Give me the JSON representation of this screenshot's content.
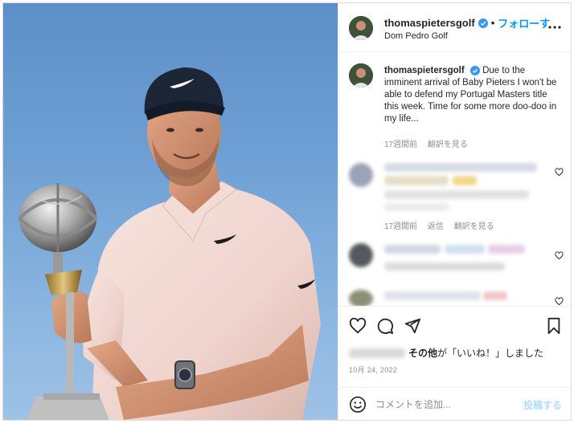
{
  "post": {
    "username": "thomaspietersgolf",
    "follow_separator": "•",
    "follow_label": "フォローす",
    "location": "Dom Pedro Golf"
  },
  "caption": {
    "username": "thomaspietersgolf",
    "text": "Due to the imminent arrival of Baby Pieters I won't be able to defend my Portugal Masters title this week. Time for some more doo-doo in my life...",
    "time": "17週間前",
    "translate": "翻訳を見る"
  },
  "comments": [
    {
      "time": "17週間前",
      "reply": "返信",
      "translate": "翻訳を見る"
    }
  ],
  "actions": {
    "likes_suffix": "が「いいね！」しました",
    "likes_bold": "その他",
    "date": "10月 24, 2022"
  },
  "comment_box": {
    "placeholder": "コメントを追加...",
    "post_label": "投稿する"
  },
  "colors": {
    "accent": "#0095f6",
    "verified": "#3897f0",
    "muted": "#8e8e8e"
  },
  "icons": {
    "more": "more-icon",
    "like": "heart-icon",
    "comment": "comment-icon",
    "share": "paper-plane-icon",
    "save": "bookmark-icon",
    "emoji": "emoji-icon"
  }
}
